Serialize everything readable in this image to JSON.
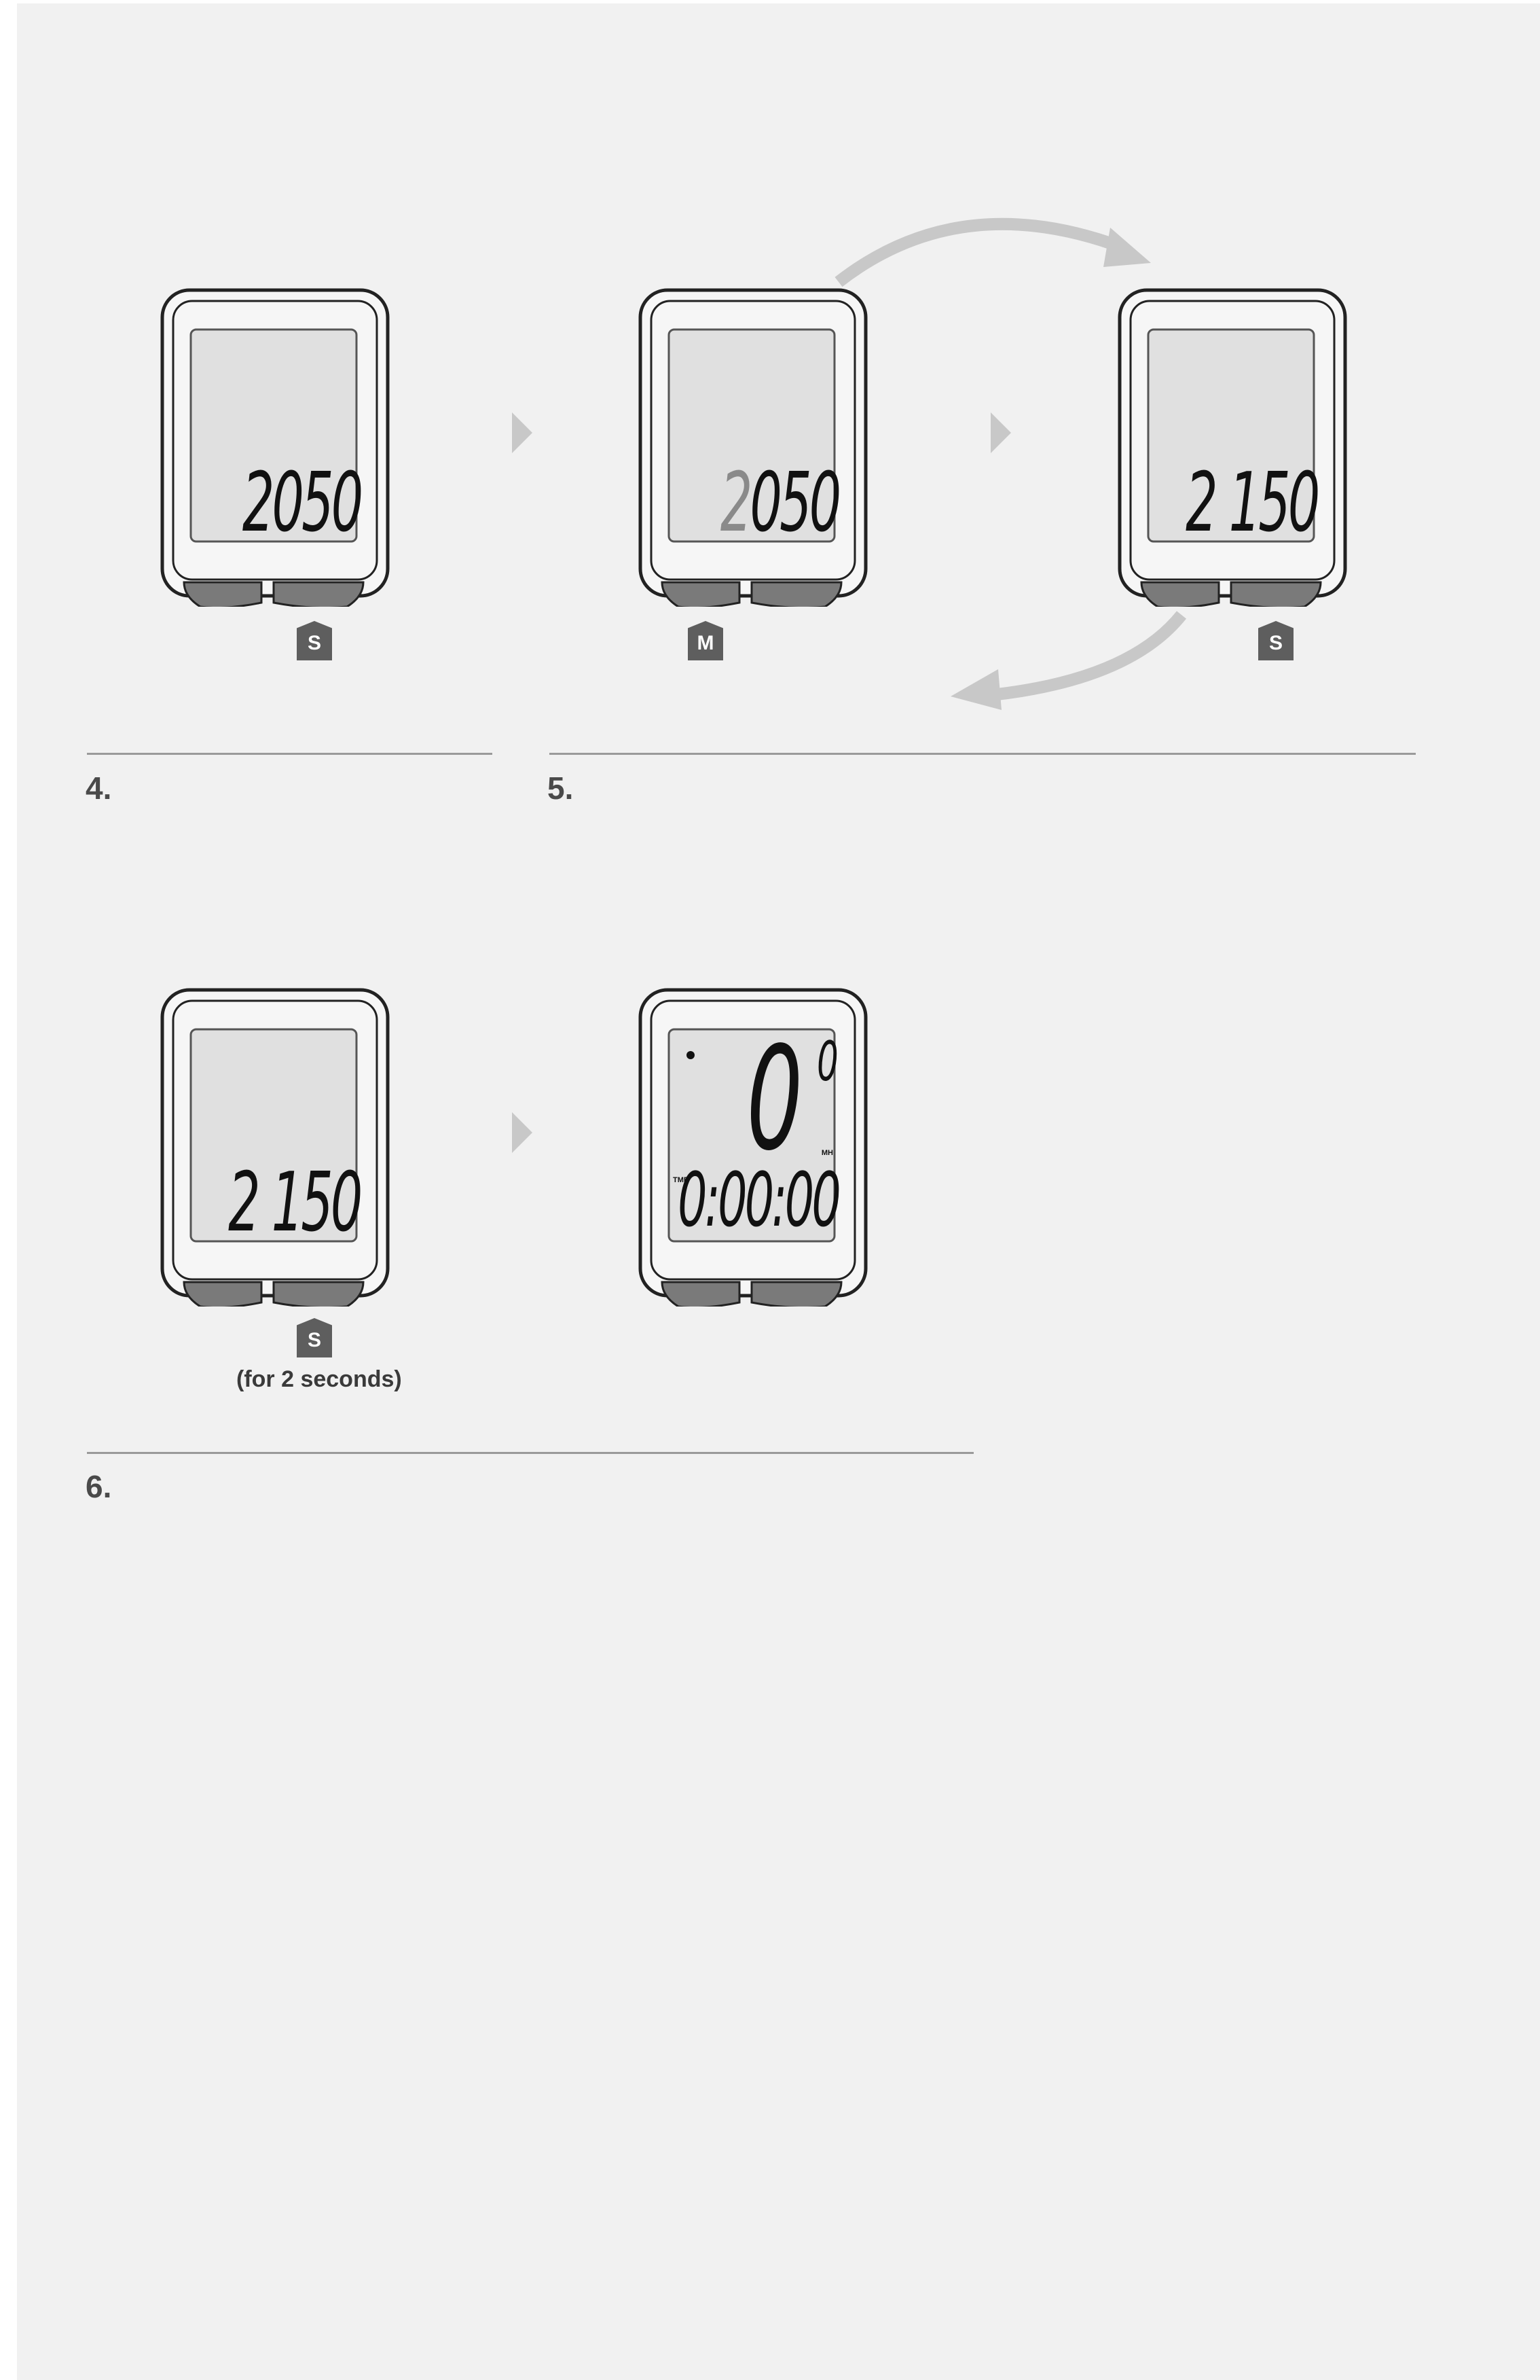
{
  "steps": [
    {
      "number": "4.",
      "display": "2050",
      "button": "S"
    },
    {
      "number": "5.",
      "display_before": "2050",
      "display_before_dim_digit": "2",
      "display_before_rest": "050",
      "display_after": "2 150",
      "button_left": "M",
      "button_right": "S"
    },
    {
      "number": "6.",
      "display": "2 150",
      "button": "S",
      "note": "(for 2 seconds)",
      "result": {
        "speed": "0",
        "speed_decimal": "0",
        "unit": "MH",
        "time_label": "TME",
        "time": "0:00:00"
      }
    }
  ],
  "colors": {
    "page_bg": "#f1f1f1",
    "badge": "#5e5e5e",
    "rule": "#9a9a9a",
    "arrow": "#c8c8c8",
    "lcd": "#e0e0e0"
  }
}
